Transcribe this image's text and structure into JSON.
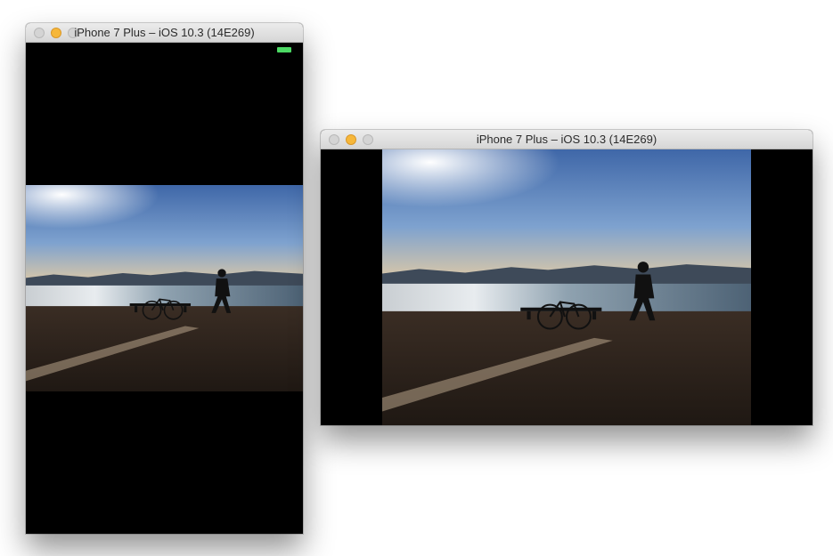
{
  "portrait_window": {
    "title": "iPhone 7 Plus – iOS 10.3 (14E269)"
  },
  "landscape_window": {
    "title": "iPhone 7 Plus – iOS 10.3 (14E269)"
  },
  "colors": {
    "battery": "#4cd964",
    "minimize": "#f6b73a",
    "screen": "#000000"
  },
  "photo": {
    "icon": "photo-icon"
  }
}
